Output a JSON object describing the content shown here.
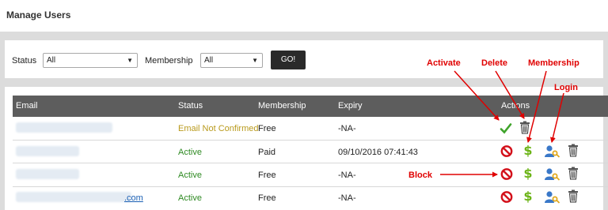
{
  "page": {
    "title": "Manage Users"
  },
  "filters": {
    "status_label": "Status",
    "status_value": "All",
    "membership_label": "Membership",
    "membership_value": "All",
    "go_label": "GO!"
  },
  "table": {
    "headers": {
      "email": "Email",
      "status": "Status",
      "membership": "Membership",
      "expiry": "Expiry",
      "actions": "Actions"
    },
    "rows": [
      {
        "email_visible": "",
        "status": "Email Not Confirmed",
        "membership": "Free",
        "expiry": "-NA-",
        "actions": [
          "activate",
          "delete"
        ]
      },
      {
        "email_visible": "",
        "status": "Active",
        "membership": "Paid",
        "expiry": "09/10/2016 07:41:43",
        "actions": [
          "block",
          "membership",
          "login",
          "delete"
        ]
      },
      {
        "email_visible": "",
        "status": "Active",
        "membership": "Free",
        "expiry": "-NA-",
        "actions": [
          "block",
          "membership",
          "login",
          "delete"
        ]
      },
      {
        "email_visible": ".com",
        "status": "Active",
        "membership": "Free",
        "expiry": "-NA-",
        "actions": [
          "block",
          "membership",
          "login",
          "delete"
        ]
      }
    ]
  },
  "annotations": {
    "activate": "Activate",
    "delete": "Delete",
    "membership": "Membership",
    "login": "Login",
    "block": "Block"
  },
  "colors": {
    "status_pending": "#b99a1c",
    "status_active": "#2f8a23",
    "header_bg": "#5d5d5d",
    "annotation": "#e00000"
  },
  "icons": {
    "activate": "checkmark-icon",
    "delete": "trash-icon",
    "block": "block-icon",
    "membership": "dollar-icon",
    "login": "user-key-icon"
  }
}
